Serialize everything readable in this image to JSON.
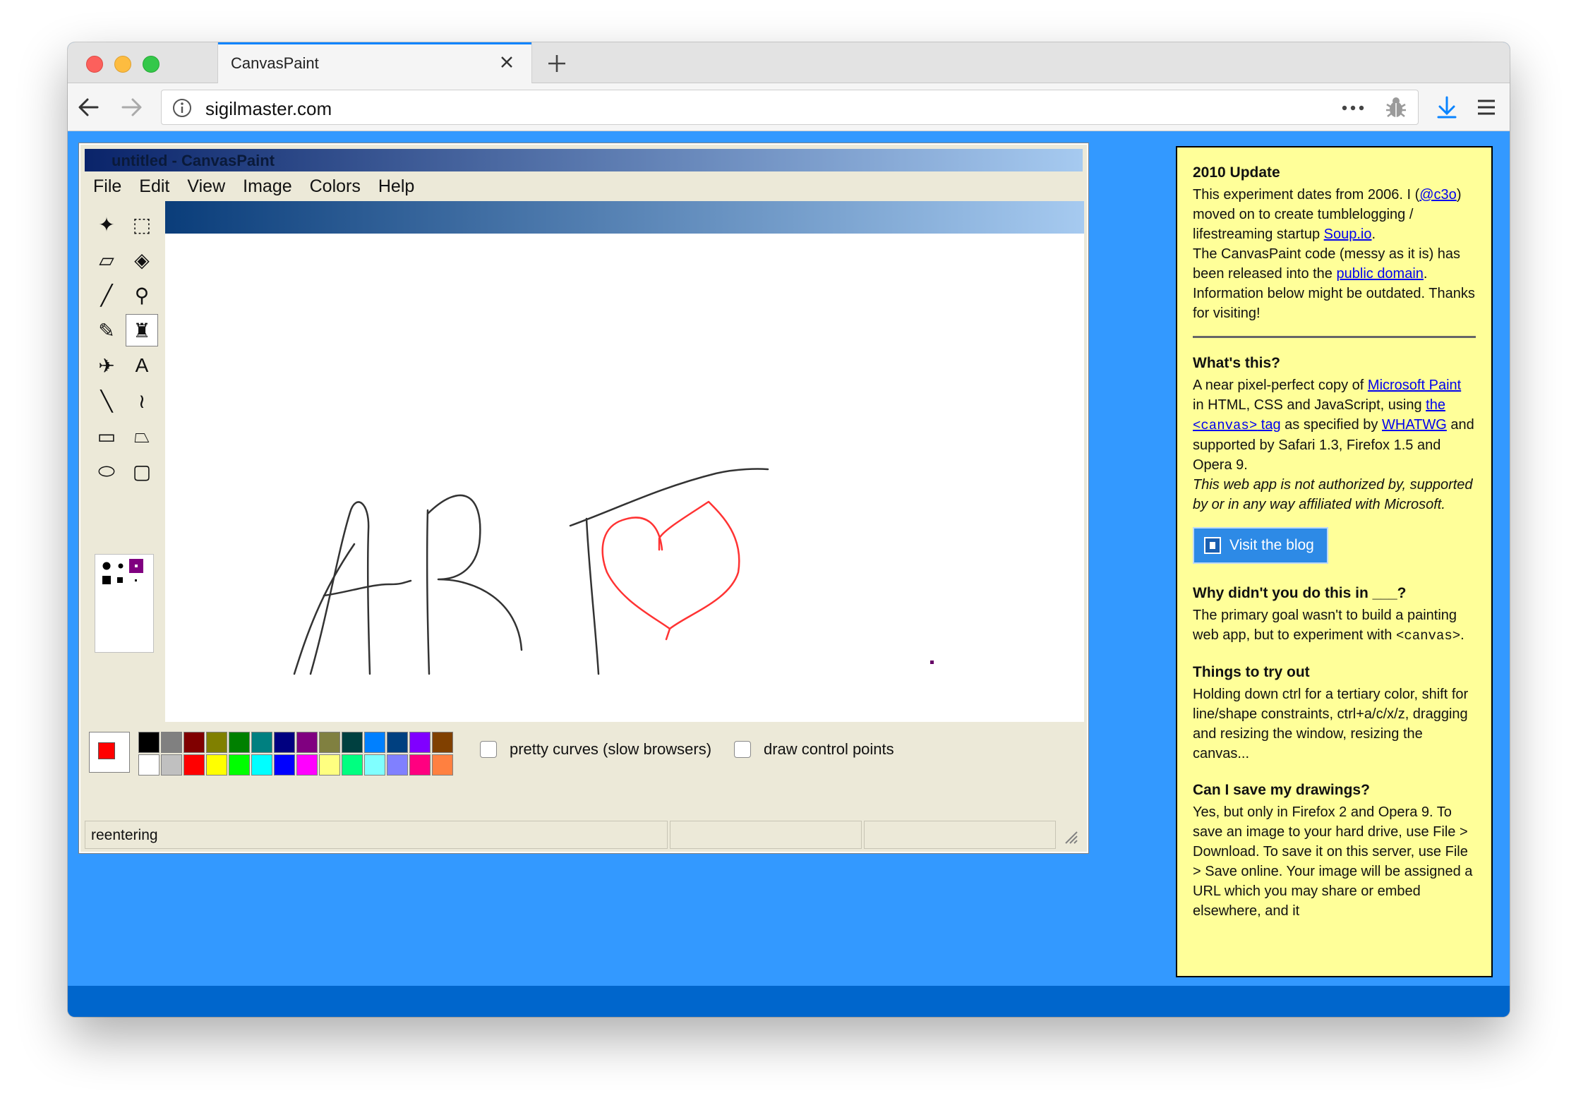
{
  "browser": {
    "tab_title": "CanvasPaint",
    "url": "sigilmaster.com",
    "new_tab_symbol": "+"
  },
  "paint": {
    "window_title": "untitled - CanvasPaint",
    "menu": [
      "File",
      "Edit",
      "View",
      "Image",
      "Colors",
      "Help"
    ],
    "tools": [
      {
        "name": "free-select-icon",
        "glyph": "✦"
      },
      {
        "name": "rect-select-icon",
        "glyph": "⬚"
      },
      {
        "name": "eraser-icon",
        "glyph": "▱"
      },
      {
        "name": "fill-bucket-icon",
        "glyph": "◈"
      },
      {
        "name": "color-picker-icon",
        "glyph": "╱"
      },
      {
        "name": "magnifier-icon",
        "glyph": "⚲"
      },
      {
        "name": "pencil-icon",
        "glyph": "✎"
      },
      {
        "name": "brush-icon",
        "glyph": "♜"
      },
      {
        "name": "airbrush-icon",
        "glyph": "✈"
      },
      {
        "name": "text-icon",
        "glyph": "A"
      },
      {
        "name": "line-icon",
        "glyph": "╲"
      },
      {
        "name": "curve-icon",
        "glyph": "≀"
      },
      {
        "name": "rectangle-icon",
        "glyph": "▭"
      },
      {
        "name": "polygon-icon",
        "glyph": "⏢"
      },
      {
        "name": "ellipse-icon",
        "glyph": "⬭"
      },
      {
        "name": "rounded-rect-icon",
        "glyph": "▢"
      }
    ],
    "active_tool": "brush-icon",
    "foreground_color": "#ff0000",
    "background_color": "#ffffff",
    "palette_top": [
      "#000000",
      "#808080",
      "#800000",
      "#808000",
      "#008000",
      "#008080",
      "#000080",
      "#800080",
      "#808040",
      "#004040",
      "#0080ff",
      "#004080",
      "#8000ff",
      "#804000"
    ],
    "palette_bottom": [
      "#ffffff",
      "#c0c0c0",
      "#ff0000",
      "#ffff00",
      "#00ff00",
      "#00ffff",
      "#0000ff",
      "#ff00ff",
      "#ffff80",
      "#00ff80",
      "#80ffff",
      "#8080ff",
      "#ff0080",
      "#ff8040"
    ],
    "option_pretty_curves": "pretty curves (slow browsers)",
    "option_control_points": "draw control points",
    "status_text": "reentering",
    "drawing_colors": {
      "ink": "#333333",
      "heart": "#ff3333",
      "dot": "#660066"
    }
  },
  "sidebar": {
    "update_heading": "2010 Update",
    "update_text_1": "This experiment dates from 2006. I (",
    "update_link_twitter": "@c3o",
    "update_text_2": ") moved on to create tumblelogging / lifestreaming startup ",
    "update_link_soup": "Soup.io",
    "update_text_3": ".",
    "update_text_4": "The CanvasPaint code (messy as it is) has been released into the ",
    "update_link_domain": "public domain",
    "update_text_5": ". Information below might be outdated. Thanks for visiting!",
    "whats_heading": "What's this?",
    "whats_text_1": "A near pixel-perfect copy of ",
    "whats_link_paint": "Microsoft Paint",
    "whats_text_2": " in HTML, CSS and JavaScript, using ",
    "whats_link_canvas_prefix": "the ",
    "whats_link_canvas_code": "<canvas>",
    "whats_link_canvas_suffix": " tag",
    "whats_text_3": " as specified by ",
    "whats_link_whatwg": "WHATWG",
    "whats_text_4": " and supported by Safari 1.3, Firefox 1.5 and Opera 9.",
    "whats_disclaimer": "This web app is not authorized by, supported by or in any way affiliated with Microsoft.",
    "visit_blog": "Visit the blog",
    "why_heading": "Why didn't you do this in ___?",
    "why_text_1": "The primary goal wasn't to build a painting web app, but to experiment with ",
    "why_code": "<canvas>",
    "why_text_2": ".",
    "try_heading": "Things to try out",
    "try_text": "Holding down ctrl for a tertiary color, shift for line/shape constraints, ctrl+a/c/x/z, dragging and resizing the window, resizing the canvas...",
    "save_heading": "Can I save my drawings?",
    "save_text": "Yes, but only in Firefox 2 and Opera 9. To save an image to your hard drive, use File > Download. To save it on this server, use File > Save online. Your image will be assigned a URL which you may share or embed elsewhere, and it"
  }
}
